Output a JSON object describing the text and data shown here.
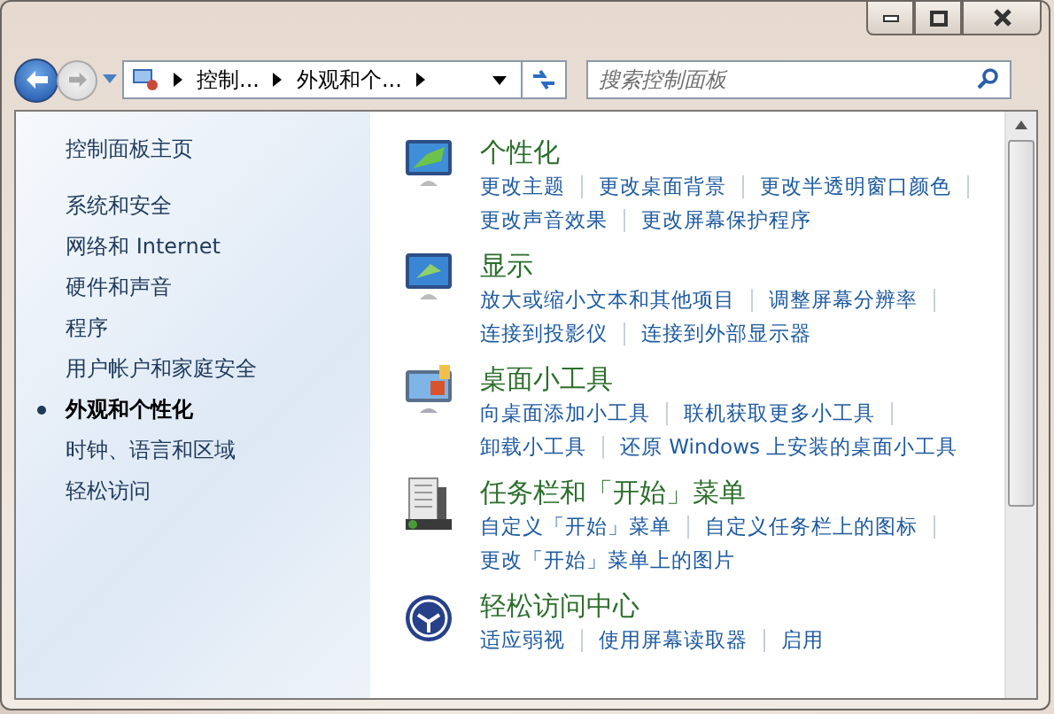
{
  "address_bar": {
    "segments": [
      "控制...",
      "外观和个..."
    ]
  },
  "search": {
    "placeholder": "搜索控制面板"
  },
  "sidebar": {
    "home": "控制面板主页",
    "items": [
      {
        "label": "系统和安全",
        "selected": false
      },
      {
        "label": "网络和 Internet",
        "selected": false
      },
      {
        "label": "硬件和声音",
        "selected": false
      },
      {
        "label": "程序",
        "selected": false
      },
      {
        "label": "用户帐户和家庭安全",
        "selected": false
      },
      {
        "label": "外观和个性化",
        "selected": true
      },
      {
        "label": "时钟、语言和区域",
        "selected": false
      },
      {
        "label": "轻松访问",
        "selected": false
      }
    ]
  },
  "categories": [
    {
      "kind": "personalization",
      "title": "个性化",
      "links": [
        [
          "更改主题",
          "更改桌面背景",
          "更改半透明窗口颜色"
        ],
        [
          "更改声音效果",
          "更改屏幕保护程序"
        ]
      ]
    },
    {
      "kind": "display",
      "title": "显示",
      "links": [
        [
          "放大或缩小文本和其他项目",
          "调整屏幕分辨率"
        ],
        [
          "连接到投影仪",
          "连接到外部显示器"
        ]
      ]
    },
    {
      "kind": "gadgets",
      "title": "桌面小工具",
      "links": [
        [
          "向桌面添加小工具",
          "联机获取更多小工具"
        ],
        [
          "卸载小工具",
          "还原 Windows 上安装的桌面小工具"
        ]
      ]
    },
    {
      "kind": "taskbar",
      "title": "任务栏和「开始」菜单",
      "links": [
        [
          "自定义「开始」菜单",
          "自定义任务栏上的图标"
        ],
        [
          "更改「开始」菜单上的图片"
        ]
      ]
    },
    {
      "kind": "ease",
      "title": "轻松访问中心",
      "links": [
        [
          "适应弱视",
          "使用屏幕读取器",
          "启用"
        ]
      ]
    }
  ]
}
